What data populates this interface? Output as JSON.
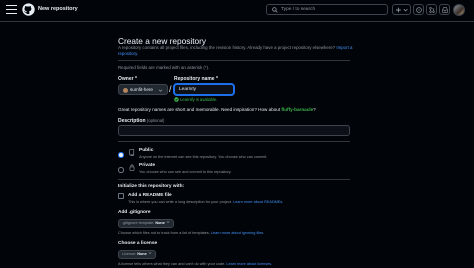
{
  "header": {
    "title": "New repository",
    "search_placeholder": "Type / to search",
    "search_key": "/"
  },
  "page": {
    "heading": "Create a new repository",
    "subtitle": "A repository contains all project files, including the revision history. Already have a project repository elsewhere?",
    "import_link": "Import a repository.",
    "required_note": "Required fields are marked with an asterisk (*).",
    "owner_label": "Owner *",
    "owner_value": "sumfit-here",
    "slash": "/",
    "repo_label": "Repository name *",
    "repo_value": "Learnify",
    "available_text": "Learnify is available.",
    "suggestion_text": "Great repository names are short and memorable. Need inspiration? How about",
    "suggestion_name": "fluffy-barnacle",
    "suggestion_end": "?",
    "description_label": "Description",
    "description_optional": "(optional)",
    "description_value": ""
  },
  "visibility": {
    "public_title": "Public",
    "public_desc": "Anyone on the internet can see this repository. You choose who can commit.",
    "public_selected": true,
    "private_title": "Private",
    "private_desc": "You choose who can see and commit to this repository.",
    "private_selected": false
  },
  "init": {
    "title": "Initialize this repository with:",
    "readme_label": "Add a README file",
    "readme_checked": false,
    "readme_hint": "This is where you can write a long description for your project.",
    "readme_link": "Learn more about READMEs.",
    "gitignore_heading": "Add .gitignore",
    "gitignore_select_label": ".gitignore template:",
    "gitignore_select_value": "None",
    "gitignore_hint": "Choose which files not to track from a list of templates.",
    "gitignore_link": "Learn more about ignoring files.",
    "license_heading": "Choose a license",
    "license_select_label": "License:",
    "license_select_value": "None",
    "license_hint": "A license tells others what they can and can't do with your code.",
    "license_link": "Learn more about licenses."
  }
}
